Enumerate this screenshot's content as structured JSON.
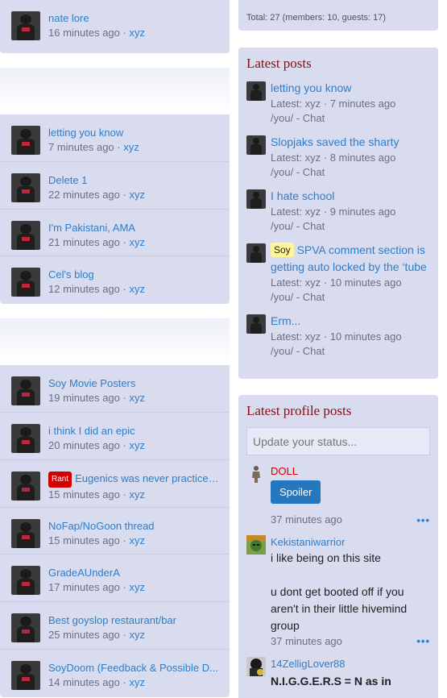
{
  "left": {
    "group1": [
      {
        "title": "nate lore",
        "time": "16 minutes ago",
        "user": "xyz"
      }
    ],
    "group2": [
      {
        "title": "letting you know",
        "time": "7 minutes ago",
        "user": "xyz"
      },
      {
        "title": "Delete 1",
        "time": "22 minutes ago",
        "user": "xyz"
      },
      {
        "title": "I'm Pakistani, AMA",
        "time": "21 minutes ago",
        "user": "xyz"
      },
      {
        "title": "Cel's blog",
        "time": "12 minutes ago",
        "user": "xyz"
      }
    ],
    "group3": [
      {
        "title": "Soy Movie Posters",
        "time": "19 minutes ago",
        "user": "xyz"
      },
      {
        "title": "i think I did an epic",
        "time": "20 minutes ago",
        "user": "xyz"
      },
      {
        "prefix": "Rant",
        "title": "Eugenics was never practiced...",
        "time": "15 minutes ago",
        "user": "xyz"
      },
      {
        "title": "NoFap/NoGoon thread",
        "time": "15 minutes ago",
        "user": "xyz"
      },
      {
        "title": "GradeAUnderA",
        "time": "17 minutes ago",
        "user": "xyz"
      },
      {
        "title": "Best goyslop restaurant/bar",
        "time": "25 minutes ago",
        "user": "xyz"
      },
      {
        "title": "SoyDoom (Feedback & Possible D...",
        "time": "14 minutes ago",
        "user": "xyz"
      }
    ],
    "separator": " · "
  },
  "online": {
    "total": "Total: 27 (members: 10, guests: 17)"
  },
  "latest_posts": {
    "heading": "Latest posts",
    "items": [
      {
        "title": "letting you know",
        "latest": "Latest: xyz · 7 minutes ago",
        "forum": "/you/ - Chat"
      },
      {
        "title": "Slopjaks saved the sharty",
        "latest": "Latest: xyz · 8 minutes ago",
        "forum": "/you/ - Chat"
      },
      {
        "title": "I hate school",
        "latest": "Latest: xyz · 9 minutes ago",
        "forum": "/you/ - Chat"
      },
      {
        "prefix": "Soy",
        "title": "SPVA comment section is getting auto locked by the ‘tube",
        "latest": "Latest: xyz · 10 minutes ago",
        "forum": "/you/ - Chat"
      },
      {
        "title": "Erm...",
        "latest": "Latest: xyz · 10 minutes ago",
        "forum": "/you/ - Chat"
      }
    ]
  },
  "profile_posts": {
    "heading": "Latest profile posts",
    "placeholder": "Update your status...",
    "items": [
      {
        "name": "DOLL",
        "name_color": "#d30000",
        "button": "Spoiler",
        "time": "37 minutes ago",
        "more": "•••"
      },
      {
        "name": "Kekistaniwarrior",
        "name_color": "#2e7ec9",
        "lines": [
          "i like being on this site",
          "",
          "u dont get booted off if you aren't in their little hivemind group"
        ],
        "time": "37 minutes ago",
        "more": "•••"
      },
      {
        "name": "14ZelligLover88",
        "name_color": "#2e7ec9",
        "text_bold": "N.I.G.G.E.R.S = N as in"
      }
    ]
  }
}
